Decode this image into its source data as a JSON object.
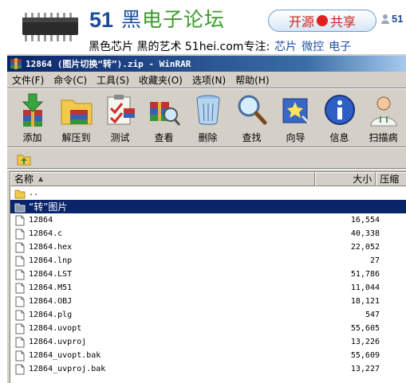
{
  "banner": {
    "site_number": "51",
    "site_name_part1": "黑",
    "site_name_part2": "电子论坛",
    "pill_left": "开源",
    "pill_right": "共享",
    "user_text": "51",
    "tagline": "黑色芯片 黑的艺术 51hei.com专注:",
    "tagline_links": [
      "芯片",
      "微控",
      "电子"
    ]
  },
  "window": {
    "title": "12864 (图片切换“转”).zip - WinRAR"
  },
  "menu": [
    "文件(F)",
    "命令(C)",
    "工具(S)",
    "收藏夹(O)",
    "选项(N)",
    "帮助(H)"
  ],
  "toolbar": [
    {
      "label": "添加",
      "icon": "add-archive-icon"
    },
    {
      "label": "解压到",
      "icon": "extract-folder-icon"
    },
    {
      "label": "测试",
      "icon": "test-clipboard-icon"
    },
    {
      "label": "查看",
      "icon": "view-books-icon"
    },
    {
      "label": "删除",
      "icon": "recycle-bin-icon"
    },
    {
      "label": "查找",
      "icon": "magnifier-icon"
    },
    {
      "label": "向导",
      "icon": "wizard-icon"
    },
    {
      "label": "信息",
      "icon": "info-icon"
    },
    {
      "label": "扫描病",
      "icon": "doctor-scan-icon"
    }
  ],
  "columns": {
    "name": "名称",
    "size": "大小",
    "packed": "压缩"
  },
  "files": [
    {
      "name": "..",
      "size": "",
      "type": "parent"
    },
    {
      "name": "“转”图片",
      "size": "",
      "type": "folder",
      "selected": true
    },
    {
      "name": "12864",
      "size": "16,554",
      "type": "file"
    },
    {
      "name": "12864.c",
      "size": "40,338",
      "type": "file"
    },
    {
      "name": "12864.hex",
      "size": "22,052",
      "type": "file"
    },
    {
      "name": "12864.lnp",
      "size": "27",
      "type": "file"
    },
    {
      "name": "12864.LST",
      "size": "51,786",
      "type": "file"
    },
    {
      "name": "12864.M51",
      "size": "11,044",
      "type": "file"
    },
    {
      "name": "12864.OBJ",
      "size": "18,121",
      "type": "file"
    },
    {
      "name": "12864.plg",
      "size": "547",
      "type": "file"
    },
    {
      "name": "12864.uvopt",
      "size": "55,605",
      "type": "file"
    },
    {
      "name": "12864.uvproj",
      "size": "13,226",
      "type": "file"
    },
    {
      "name": "12864_uvopt.bak",
      "size": "55,609",
      "type": "file"
    },
    {
      "name": "12864_uvproj.bak",
      "size": "13,227",
      "type": "file"
    }
  ]
}
